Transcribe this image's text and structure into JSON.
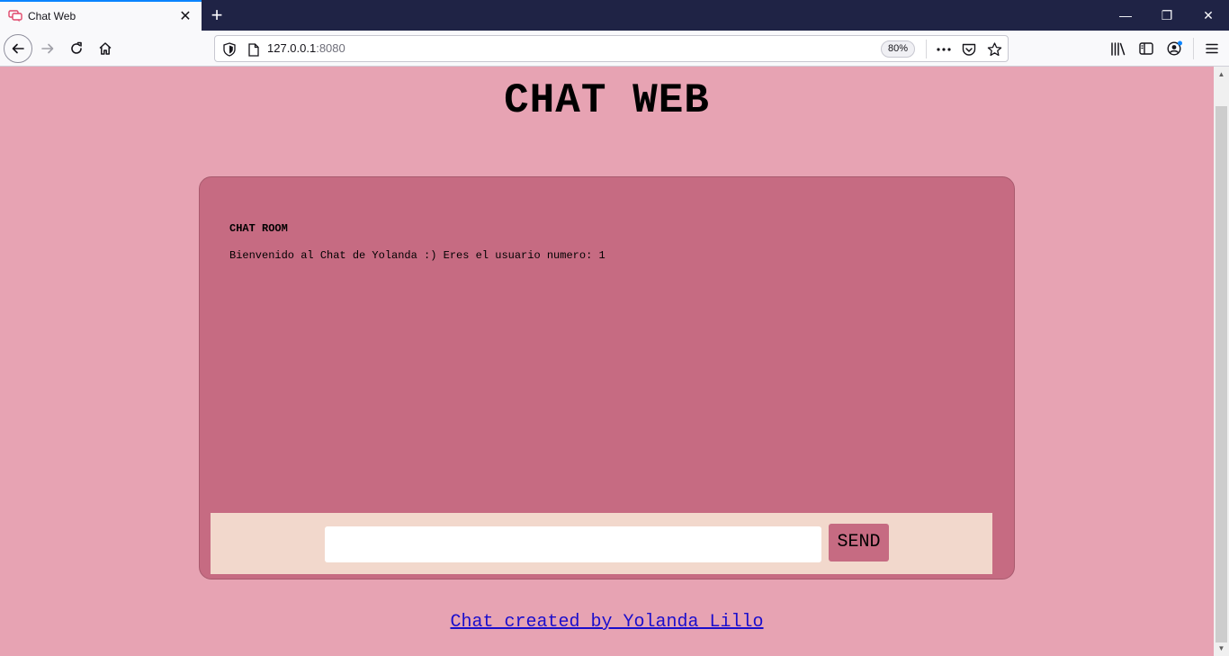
{
  "browser": {
    "tab_title": "Chat Web",
    "new_tab_symbol": "+",
    "url_host": "127.0.0.1",
    "url_port": ":8080",
    "zoom": "80%",
    "window_controls": {
      "minimize": "—",
      "restore": "❐",
      "close": "✕"
    }
  },
  "page": {
    "title": "CHAT WEB",
    "chat_room": {
      "heading": "CHAT ROOM",
      "messages": [
        "Bienvenido al Chat de Yolanda :) Eres el usuario numero: 1"
      ]
    },
    "compose": {
      "input_value": "",
      "send_label": "SEND"
    },
    "footer_link": "Chat created by Yolanda Lillo"
  },
  "colors": {
    "page_background": "#e7a3b3",
    "panel": "#c66b82",
    "compose_bar": "#f2d8cc",
    "link": "#1a0dcc",
    "tab_strip": "#1f2345"
  },
  "icons": [
    "chat-favicon-icon",
    "close-icon",
    "plus-icon",
    "back-arrow-icon",
    "forward-arrow-icon",
    "reload-icon",
    "home-icon",
    "shield-icon",
    "page-icon",
    "more-dots-icon",
    "pocket-icon",
    "star-icon",
    "library-icon",
    "sidebar-icon",
    "account-icon",
    "menu-icon"
  ]
}
